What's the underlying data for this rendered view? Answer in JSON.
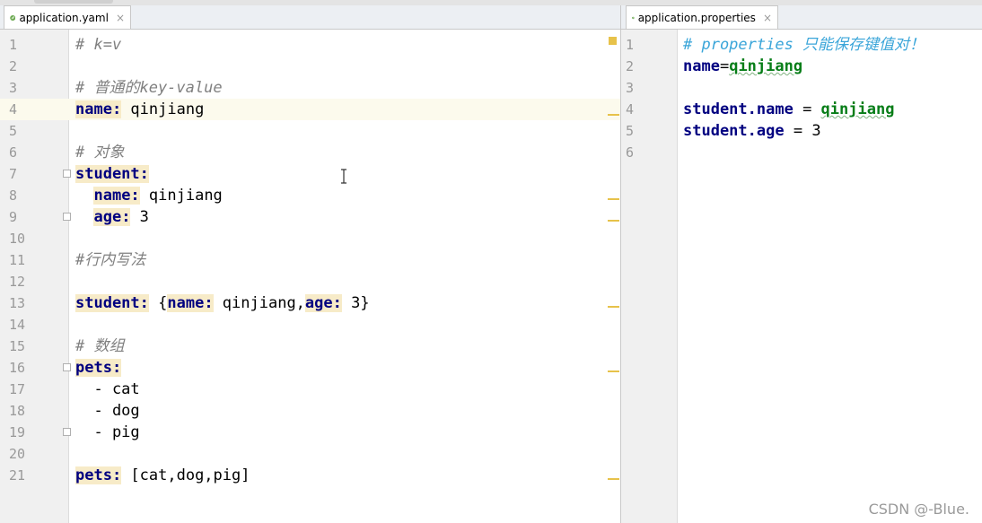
{
  "colors": {
    "keyword": "#000080",
    "comment": "#808080",
    "properties_comment": "#3aa5d9",
    "string_value": "#067d17",
    "key_highlight": "#f7ebc8",
    "current_line": "#fcfaed",
    "stripe_mark": "#e7c24a"
  },
  "icons": {
    "tab_file": "spring-leaf-icon",
    "tab_close": "close-icon",
    "fold": "fold-marker-icon",
    "cursor": "text-cursor-icon"
  },
  "left_editor": {
    "tab": {
      "title": "application.yaml",
      "close": "×"
    },
    "lines": [
      {
        "n": "1",
        "c": "# k=v"
      },
      {
        "n": "2",
        "c": ""
      },
      {
        "n": "3",
        "c": "# 普通的key-value"
      },
      {
        "n": "4",
        "k": "name:",
        "v": " qinjiang"
      },
      {
        "n": "5",
        "c": ""
      },
      {
        "n": "6",
        "c": "# 对象"
      },
      {
        "n": "7",
        "k": "student:",
        "v": ""
      },
      {
        "n": "8",
        "k": "name:",
        "v": " qinjiang",
        "ind": "  "
      },
      {
        "n": "9",
        "k": "age:",
        "v": " 3",
        "ind": "  "
      },
      {
        "n": "10",
        "c": ""
      },
      {
        "n": "11",
        "c": "#行内写法"
      },
      {
        "n": "12",
        "c": ""
      },
      {
        "n": "13",
        "k": "student:",
        "v": " {",
        "k2": "name:",
        "v2": " qinjiang,",
        "k3": "age:",
        "v3": " 3}"
      },
      {
        "n": "14",
        "c": ""
      },
      {
        "n": "15",
        "c": "# 数组"
      },
      {
        "n": "16",
        "k": "pets:",
        "v": ""
      },
      {
        "n": "17",
        "v": "  - cat"
      },
      {
        "n": "18",
        "v": "  - dog"
      },
      {
        "n": "19",
        "v": "  - pig"
      },
      {
        "n": "20",
        "c": ""
      },
      {
        "n": "21",
        "k": "pets:",
        "v": " [cat,dog,pig]"
      }
    ]
  },
  "right_editor": {
    "tab": {
      "title": "application.properties",
      "close": "×"
    },
    "lines": [
      {
        "n": "1",
        "c": "# properties 只能保存键值对！"
      },
      {
        "n": "2",
        "k": "name",
        "eq": "=",
        "v": "qinjiang"
      },
      {
        "n": "3",
        "c": ""
      },
      {
        "n": "4",
        "k": "student.name",
        "eq": " = ",
        "v": "qinjiang"
      },
      {
        "n": "5",
        "k": "student.age",
        "eq": " = ",
        "v": "3"
      },
      {
        "n": "6",
        "c": ""
      }
    ]
  },
  "watermark": "CSDN @-Blue."
}
